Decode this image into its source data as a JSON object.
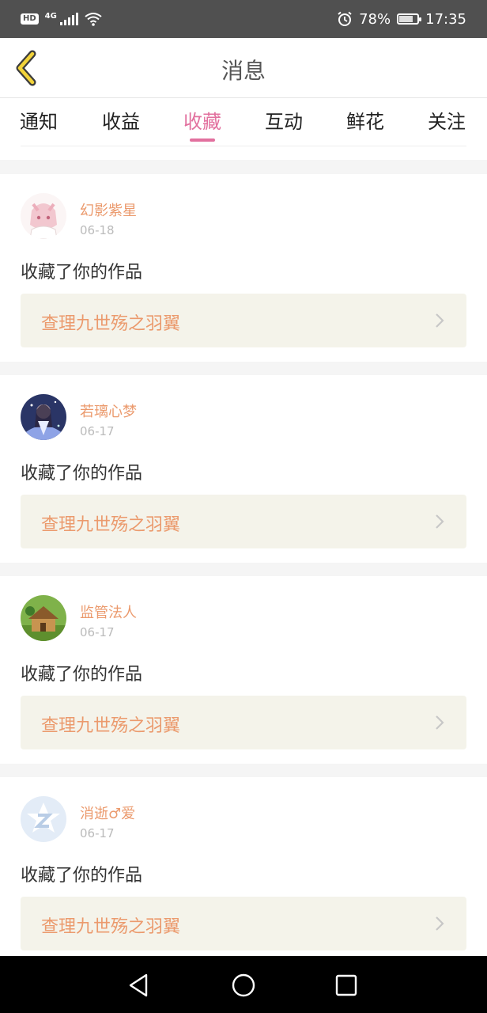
{
  "status_bar": {
    "hd": "HD",
    "network": "4G",
    "battery": "78%",
    "time": "17:35"
  },
  "header": {
    "title": "消息"
  },
  "tabs": [
    {
      "label": "通知",
      "active": false
    },
    {
      "label": "收益",
      "active": false
    },
    {
      "label": "收藏",
      "active": true
    },
    {
      "label": "互动",
      "active": false
    },
    {
      "label": "鲜花",
      "active": false
    },
    {
      "label": "关注",
      "active": false
    }
  ],
  "messages": [
    {
      "user": "幻影紫星",
      "date": "06-18",
      "action": "收藏了你的作品",
      "work": "查理九世殇之羽翼"
    },
    {
      "user": "若璃心梦",
      "date": "06-17",
      "action": "收藏了你的作品",
      "work": "查理九世殇之羽翼"
    },
    {
      "user": "监管法人",
      "date": "06-17",
      "action": "收藏了你的作品",
      "work": "查理九世殇之羽翼"
    },
    {
      "user": "消逝♂爱",
      "date": "06-17",
      "action": "收藏了你的作品",
      "work": "查理九世殇之羽翼"
    }
  ],
  "colors": {
    "accent_pink": "#e2709e",
    "username_orange": "#eb9a6d",
    "link_bg": "#f4f3ea"
  }
}
